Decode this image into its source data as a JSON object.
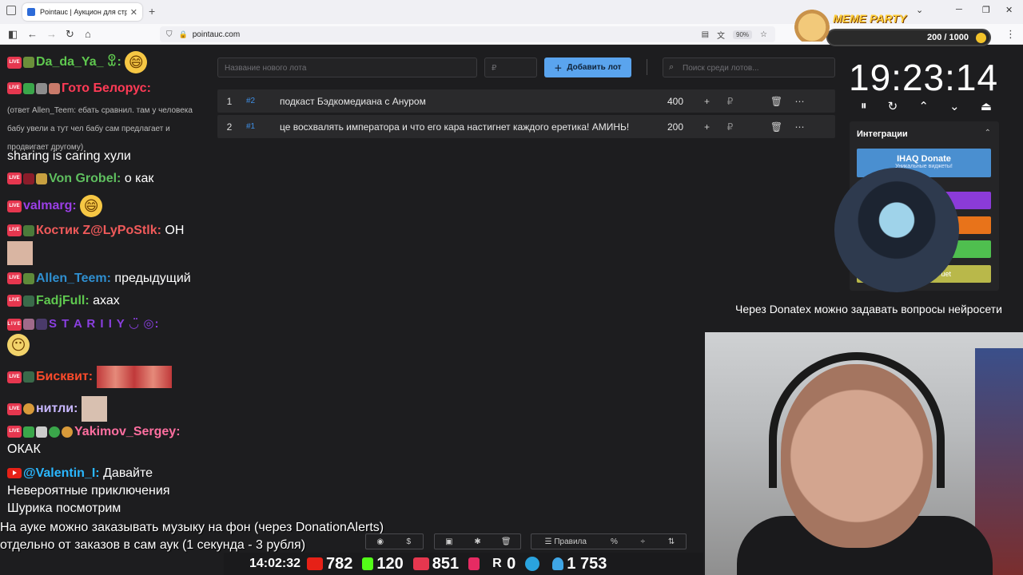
{
  "browser": {
    "tab_title": "Pointauc | Аукцион для стримеров",
    "url": "pointauc.com",
    "zoom": "90%",
    "tab_close": "✕",
    "new_tab": "+"
  },
  "meme_party": {
    "title": "MEME PARTY",
    "progress": "200 / 1000",
    "progress_value": 0.2
  },
  "chat": [
    {
      "user": "Da_da_Ya_ ꀾ:",
      "text": "😄",
      "color": "#5fc84f"
    },
    {
      "user": "Гото Белорус:",
      "text": "",
      "color": "#ff3b56"
    },
    {
      "user": "",
      "text": "(ответ Allen_Teem: ебать сравнил. там у человека бабу увели а тут чел бабу сам предлагает и продвигает другому)",
      "color": "#bbb"
    },
    {
      "user": "",
      "text": "sharing is caring хули",
      "color": "#fff"
    },
    {
      "user": "Von Grobel:",
      "text": "о как",
      "color": "#5fbf5f"
    },
    {
      "user": "valmarg:",
      "text": "😄",
      "color": "#9b3fe6"
    },
    {
      "user": "Костик Z@LyPoStlk:",
      "text": "ОН",
      "color": "#f05a5a"
    },
    {
      "user": "Allen_Teem:",
      "text": "предыдущий",
      "color": "#2f8fd0"
    },
    {
      "user": "FadjFull:",
      "text": "ахах",
      "color": "#5fc84f"
    },
    {
      "user": "S T A R I I Y ◡̈ ◎:",
      "text": "",
      "color": "#8a3fe0"
    },
    {
      "user": "Бисквит:",
      "text": "",
      "color": "#ff4b2b"
    },
    {
      "user": "нитли:",
      "text": "",
      "color": "#c9b8ff"
    },
    {
      "user": "Yakimov_Sergey:",
      "text": "ОКАК",
      "color": "#ff6fa0"
    },
    {
      "user": "@Valentin_I:",
      "text": "Давайте Невероятные приключения Шурика посмотрим",
      "color": "#2ab7ff"
    }
  ],
  "auction": {
    "new_lot_placeholder": "Название нового лота",
    "amount_placeholder": "₽",
    "add_button": "Добавить лот",
    "search_placeholder": "Поиск среди лотов...",
    "lots": [
      {
        "n": "1",
        "id": "#2",
        "name": "подкаст Бэдкомедиана с Ануром",
        "amount": "400"
      },
      {
        "n": "2",
        "id": "#1",
        "name": "це восхвалять императора и что его кара настигнет каждого еретика! АМИНЬ!",
        "amount": "200"
      }
    ],
    "row_actions": {
      "plus": "+",
      "currency": "₽",
      "delete": "🗑",
      "more": "⋯"
    }
  },
  "timer": {
    "time": "19:23:14",
    "controls": [
      "⏸",
      "↻",
      "⌃",
      "⌄",
      "⏏"
    ]
  },
  "integrations": {
    "header": "Интеграции",
    "collapse": "⌃",
    "items": [
      {
        "label": "IHAQ Donate",
        "sub": "Уникальные виджеты!",
        "color": "#4a8fd0"
      },
      {
        "label": "",
        "sub": "",
        "color": "#8b3bd8"
      },
      {
        "label": "",
        "sub": "",
        "color": "#e8731a"
      },
      {
        "label": "",
        "sub": "",
        "color": "#4fbf4f"
      },
      {
        "label": "uet",
        "sub": "",
        "color": "#b9b84a"
      }
    ]
  },
  "overlay": {
    "donatex": "Через Donatex можно задавать вопросы нейросети",
    "music_line1": "На ауке можно заказывать музыку на фон (через DonationAlerts)",
    "music_line2": "отдельно от заказов в сам аук (1 секунда - 3 рубля)",
    "toolbar_a": [
      "",
      "$"
    ],
    "toolbar_b": [
      "",
      "",
      ""
    ],
    "toolbar_c": {
      "rules": "Правила",
      "percent": "%",
      "split": "÷",
      "sort": "⇅"
    }
  },
  "stats": {
    "time": "14:02:32",
    "youtube": "782",
    "kick": "120",
    "live": "851",
    "r": "0",
    "telegram": "",
    "viewers": "1 753"
  }
}
